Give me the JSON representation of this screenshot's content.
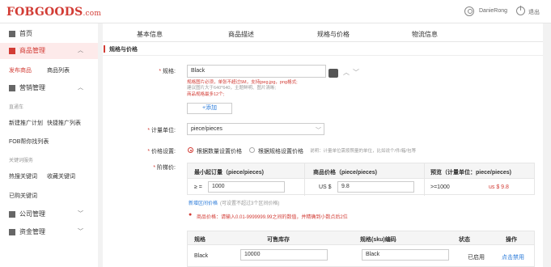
{
  "brand": {
    "logo": "FOBGOODS",
    "logo_suffix": ".com",
    "accent": "#d23c35"
  },
  "header": {
    "username": "DanieRong",
    "logout": "退出"
  },
  "sidebar": {
    "home": "首页",
    "product_mgmt": "商品管理",
    "publish": "发布商品",
    "product_list": "商品列表",
    "marketing": "营销管理",
    "group_promo": "直通车",
    "new_plan": "新建推广计划",
    "quick_plan": "快捷推广列表",
    "fob_list": "FOB帮你找列表",
    "group_keyword": "关键词服务",
    "hot_keywords": "热搜关键词",
    "fav_keywords": "收藏关键词",
    "bought_keywords": "已购关键词",
    "company": "公司管理",
    "finance": "资金管理"
  },
  "tabs": [
    "基本信息",
    "商品描述",
    "规格与价格",
    "物流信息"
  ],
  "section_title": "规格与价格",
  "spec": {
    "label": "规格:",
    "value": "Black",
    "hint1": "规格图片必须，单张不超过5M，支持jpeg,jpg，png格式;",
    "hint2": "建议图片大于640*640，主题鲜明、图片清晰;",
    "hint3": "商品规格最多12个;",
    "add": "+添加"
  },
  "unit": {
    "label": "计量单位:",
    "value": "piece/pieces"
  },
  "price_setting": {
    "label": "价格设置:",
    "opt1": "根据数量设置价格",
    "opt2": "根据规格设置价格",
    "note": "说明：计量单位需按照量的单位，比如说个/件/箱/包等"
  },
  "tier": {
    "label": "阶梯价:",
    "col1": "最小起订量（piece/pieces)",
    "col2": "商品价格（piece/pieces)",
    "col3": "预览（计量单位：piece/pieces)",
    "ge": "≥ =",
    "qty": "1000",
    "currency": "US $",
    "price": "9.8",
    "preview_qty": ">=1000",
    "preview_price": "us $ 9.8",
    "add_link": "新增区间价格",
    "add_note": "(可设置不超过3个区间价格)",
    "warn": "商品价格：请输入0.01-9999999.99之间的数值，并精确到小数点后2位"
  },
  "sku": {
    "headers": [
      "规格",
      "可售库存",
      "规格(sku)编码",
      "状态",
      "操作"
    ],
    "row": {
      "spec": "Black",
      "stock": "10000",
      "code": "Black",
      "status": "已启用",
      "action": "点击禁用"
    }
  }
}
